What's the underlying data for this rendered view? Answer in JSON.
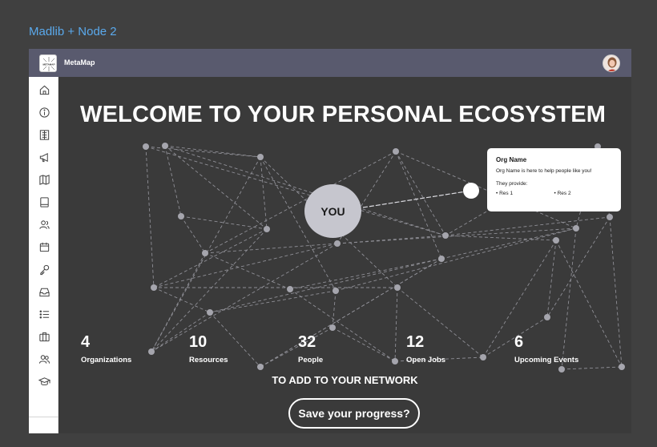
{
  "frame": {
    "label": "Madlib + Node 2"
  },
  "topbar": {
    "app_name": "MetaMap",
    "logo_text": "METAMAP"
  },
  "sidebar": {
    "items": [
      {
        "icon": "home-icon"
      },
      {
        "icon": "info-icon"
      },
      {
        "icon": "directory-icon"
      },
      {
        "icon": "megaphone-icon"
      },
      {
        "icon": "map-icon"
      },
      {
        "icon": "book-icon"
      },
      {
        "icon": "people-icon"
      },
      {
        "icon": "calendar-icon"
      },
      {
        "icon": "key-icon"
      },
      {
        "icon": "inbox-icon"
      },
      {
        "icon": "list-icon"
      },
      {
        "icon": "briefcase-icon"
      },
      {
        "icon": "users-icon"
      },
      {
        "icon": "graduation-cap-icon"
      }
    ]
  },
  "main": {
    "headline": "WELCOME TO YOUR PERSONAL ECOSYSTEM",
    "you_label": "YOU",
    "stats": [
      {
        "number": "4",
        "label": "Organizations"
      },
      {
        "number": "10",
        "label": "Resources"
      },
      {
        "number": "32",
        "label": "People"
      },
      {
        "number": "12",
        "label": "Open Jobs"
      },
      {
        "number": "6",
        "label": "Upcoming Events"
      }
    ],
    "network_cta": "TO ADD TO YOUR NETWORK",
    "save_button": "Save your progress?"
  },
  "popover": {
    "title": "Org Name",
    "description": "Org Name is here to help people like you!",
    "provides_label": "They provide:",
    "items": [
      "Res 1",
      "Res 2"
    ]
  },
  "colors": {
    "background": "#404040",
    "app_background": "#3a3a3a",
    "topbar": "#595a6e",
    "frame_label": "#5aa9ec",
    "node": "#a5a5ad",
    "you_node": "#c6c6ce"
  }
}
